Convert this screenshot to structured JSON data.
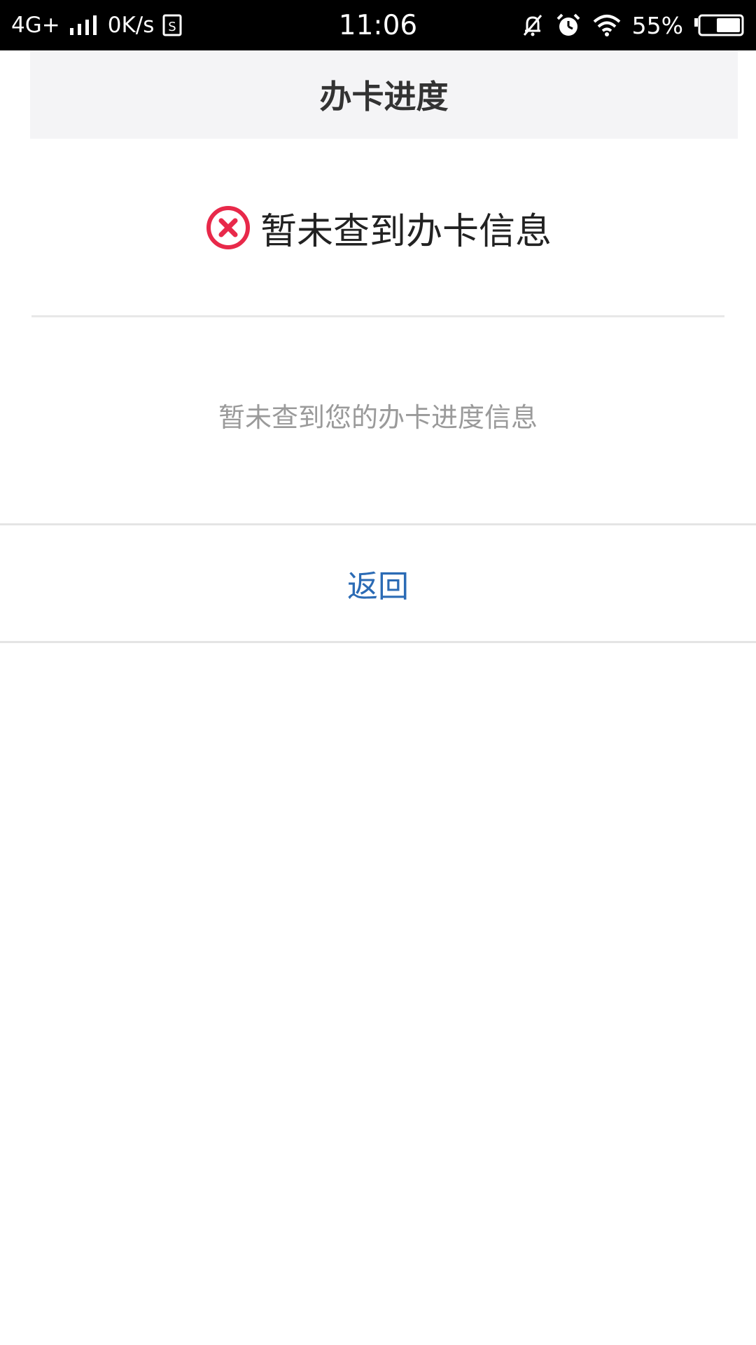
{
  "status_bar": {
    "network": "4G+",
    "speed": "0K/s",
    "time": "11:06",
    "battery": "55%",
    "icons": [
      "signal-icon",
      "sim-icon",
      "mute-bell-icon",
      "alarm-icon",
      "wifi-icon",
      "battery-icon"
    ]
  },
  "header": {
    "title": "办卡进度"
  },
  "result": {
    "icon": "error-circle-icon",
    "icon_color": "#e8294a",
    "message": "暂未查到办卡信息"
  },
  "detail": {
    "message": "暂未查到您的办卡进度信息"
  },
  "actions": {
    "back_label": "返回",
    "back_color": "#2b6bb5"
  }
}
